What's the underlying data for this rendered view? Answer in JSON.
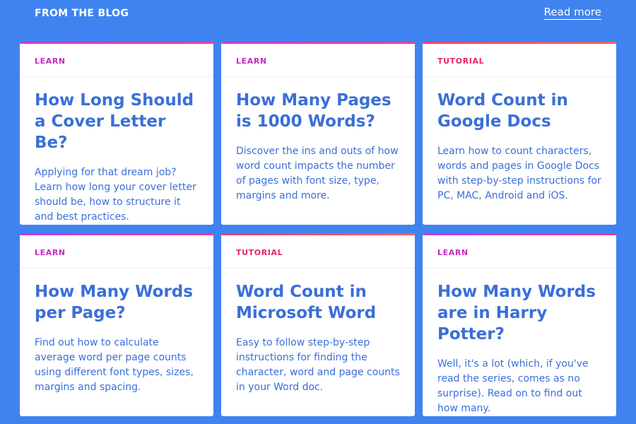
{
  "header": {
    "section_title": "FROM THE BLOG",
    "read_more_label": "Read more"
  },
  "cards": [
    {
      "category": "LEARN",
      "title": "How Long Should a Cover Letter Be?",
      "description": "Applying for that dream job? Learn how long your cover letter should be, how to structure it and best practices."
    },
    {
      "category": "LEARN",
      "title": "How Many Pages is 1000 Words?",
      "description": "Discover the ins and outs of how word count impacts the number of pages with font size, type, margins and more."
    },
    {
      "category": "TUTORIAL",
      "title": "Word Count in Google Docs",
      "description": "Learn how to count characters, words and pages in Google Docs with step-by-step instructions for PC, MAC, Android and iOS."
    },
    {
      "category": "LEARN",
      "title": "How Many Words per Page?",
      "description": "Find out how to calculate average word per page counts using different font types, sizes, margins and spacing."
    },
    {
      "category": "TUTORIAL",
      "title": "Word Count in Microsoft Word",
      "description": "Easy to follow step-by-step instructions for finding the character, word and page counts in your Word doc."
    },
    {
      "category": "LEARN",
      "title": "How Many Words are in Harry Potter?",
      "description": "Well, it's a lot (which, if you've read the series, comes as no surprise). Read on to find out how many."
    }
  ],
  "colors": {
    "background": "#3f83f0",
    "card_text": "#3a6fd8",
    "learn_accent": "#c42bc0",
    "tutorial_accent": "#e8265e"
  }
}
